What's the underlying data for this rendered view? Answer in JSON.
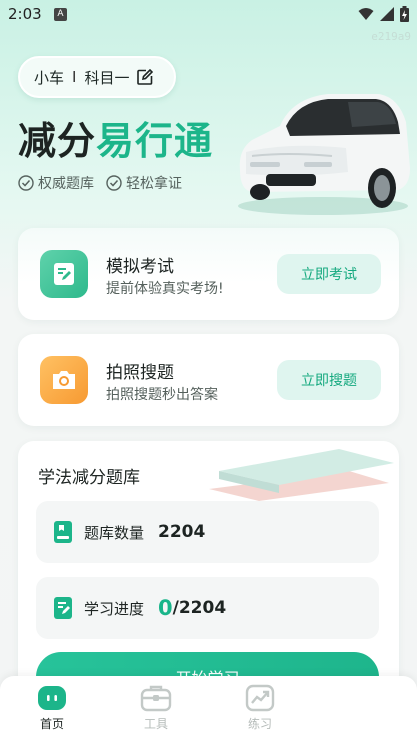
{
  "status_bar": {
    "time": "2:03",
    "notification_badge": "A"
  },
  "watermark": "e219a9",
  "subject_pill": {
    "vehicle": "小车",
    "separator": "I",
    "subject": "科目一"
  },
  "brand": {
    "part1": "减分",
    "part2": "易行通"
  },
  "badges": [
    {
      "label": "权威题库"
    },
    {
      "label": "轻松拿证"
    }
  ],
  "cards": {
    "exam": {
      "title": "模拟考试",
      "subtitle": "提前体验真实考场!",
      "button": "立即考试"
    },
    "photo": {
      "title": "拍照搜题",
      "subtitle": "拍照搜题秒出答案",
      "button": "立即搜题"
    }
  },
  "bank": {
    "title": "学法减分题库",
    "count_label": "题库数量",
    "count_value": "2204",
    "progress_label": "学习进度",
    "progress_done": "0",
    "progress_total": "/2204",
    "start_button": "开始学习"
  },
  "nav": [
    {
      "label": "首页",
      "icon": "home-icon",
      "active": true
    },
    {
      "label": "工具",
      "icon": "toolbox-icon",
      "active": false
    },
    {
      "label": "练习",
      "icon": "chart-icon",
      "active": false
    },
    {
      "label": "",
      "icon": "",
      "active": false
    }
  ],
  "colors": {
    "accent": "#1cb58a",
    "accent_light": "#dff5ef",
    "orange": "#f79a32"
  }
}
